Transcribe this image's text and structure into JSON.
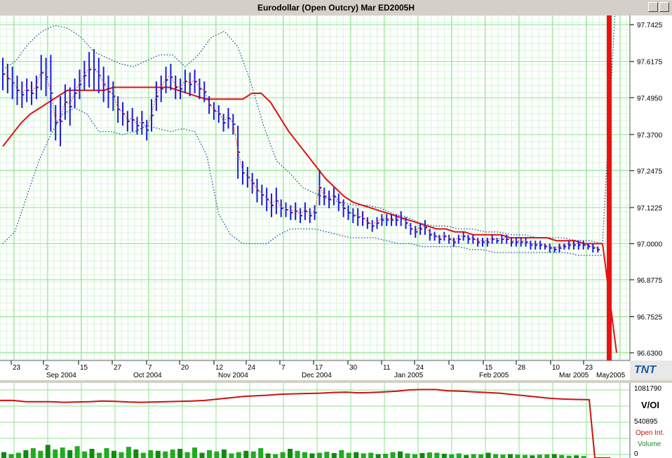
{
  "window": {
    "title": "Eurodollar (Open Outcry) Mar ED2005H"
  },
  "price_axis": {
    "labels": [
      "97.7425",
      "97.6175",
      "97.4950",
      "97.3700",
      "97.2475",
      "97.1225",
      "97.0000",
      "96.8775",
      "96.7525",
      "96.6300"
    ]
  },
  "date_axis": {
    "day_labels": [
      "23",
      "2",
      "15",
      "27",
      "7",
      "20",
      "12",
      "24",
      "7",
      "17",
      "30",
      "11",
      "24",
      "3",
      "15",
      "28",
      "10",
      "23"
    ],
    "month_labels": [
      "Sep 2004",
      "Oct 2004",
      "Nov 2004",
      "Dec 2004",
      "Jan 2005",
      "Feb 2005",
      "Mar 2005",
      "May2005"
    ]
  },
  "logo": {
    "text": "TNT"
  },
  "lower_panel": {
    "axis_labels": [
      "1081790",
      "540895",
      "0"
    ],
    "title": "V/OI",
    "legend": [
      "Open Int.",
      "Volume"
    ]
  },
  "colors": {
    "grid": "#8fe38f",
    "bars": "#1a1adc",
    "ma": "#e01010",
    "bands": "#1a4a9a",
    "volume": "#22aa22",
    "oi": "#d01010",
    "bg": "#ffffff"
  },
  "chart_data": [
    {
      "type": "ohlc",
      "title": "Eurodollar (Open Outcry) Mar ED2005H",
      "ylim": [
        96.63,
        97.8
      ],
      "yticks": [
        97.7425,
        97.6175,
        97.495,
        97.37,
        97.2475,
        97.1225,
        97.0,
        96.8775,
        96.7525,
        96.63
      ],
      "bars": [
        {
          "h": 97.63,
          "l": 97.52
        },
        {
          "h": 97.61,
          "l": 97.51
        },
        {
          "h": 97.6,
          "l": 97.49
        },
        {
          "h": 97.57,
          "l": 97.47
        },
        {
          "h": 97.55,
          "l": 97.46
        },
        {
          "h": 97.56,
          "l": 97.48
        },
        {
          "h": 97.55,
          "l": 97.47
        },
        {
          "h": 97.57,
          "l": 97.49
        },
        {
          "h": 97.64,
          "l": 97.52
        },
        {
          "h": 97.63,
          "l": 97.5
        },
        {
          "h": 97.64,
          "l": 97.38
        },
        {
          "h": 97.47,
          "l": 97.35
        },
        {
          "h": 97.5,
          "l": 97.33
        },
        {
          "h": 97.54,
          "l": 97.42
        },
        {
          "h": 97.53,
          "l": 97.4
        },
        {
          "h": 97.56,
          "l": 97.46
        },
        {
          "h": 97.59,
          "l": 97.49
        },
        {
          "h": 97.62,
          "l": 97.52
        },
        {
          "h": 97.65,
          "l": 97.53
        },
        {
          "h": 97.66,
          "l": 97.52
        },
        {
          "h": 97.63,
          "l": 97.51
        },
        {
          "h": 97.6,
          "l": 97.48
        },
        {
          "h": 97.57,
          "l": 97.46
        },
        {
          "h": 97.55,
          "l": 97.45
        },
        {
          "h": 97.5,
          "l": 97.41
        },
        {
          "h": 97.48,
          "l": 97.4
        },
        {
          "h": 97.45,
          "l": 97.38
        },
        {
          "h": 97.46,
          "l": 97.38
        },
        {
          "h": 97.43,
          "l": 97.37
        },
        {
          "h": 97.45,
          "l": 97.37
        },
        {
          "h": 97.42,
          "l": 97.35
        },
        {
          "h": 97.49,
          "l": 97.38
        },
        {
          "h": 97.55,
          "l": 97.45
        },
        {
          "h": 97.57,
          "l": 97.48
        },
        {
          "h": 97.6,
          "l": 97.51
        },
        {
          "h": 97.61,
          "l": 97.52
        },
        {
          "h": 97.57,
          "l": 97.49
        },
        {
          "h": 97.56,
          "l": 97.49
        },
        {
          "h": 97.59,
          "l": 97.51
        },
        {
          "h": 97.58,
          "l": 97.5
        },
        {
          "h": 97.59,
          "l": 97.51
        },
        {
          "h": 97.56,
          "l": 97.49
        },
        {
          "h": 97.55,
          "l": 97.48
        },
        {
          "h": 97.5,
          "l": 97.44
        },
        {
          "h": 97.48,
          "l": 97.42
        },
        {
          "h": 97.47,
          "l": 97.41
        },
        {
          "h": 97.44,
          "l": 97.38
        },
        {
          "h": 97.46,
          "l": 97.39
        },
        {
          "h": 97.44,
          "l": 97.37
        },
        {
          "h": 97.4,
          "l": 97.22
        },
        {
          "h": 97.28,
          "l": 97.2
        },
        {
          "h": 97.26,
          "l": 97.19
        },
        {
          "h": 97.24,
          "l": 97.17
        },
        {
          "h": 97.22,
          "l": 97.14
        },
        {
          "h": 97.2,
          "l": 97.13
        },
        {
          "h": 97.19,
          "l": 97.11
        },
        {
          "h": 97.17,
          "l": 97.09
        },
        {
          "h": 97.19,
          "l": 97.1
        },
        {
          "h": 97.15,
          "l": 97.09
        },
        {
          "h": 97.14,
          "l": 97.09
        },
        {
          "h": 97.13,
          "l": 97.08
        },
        {
          "h": 97.14,
          "l": 97.08
        },
        {
          "h": 97.12,
          "l": 97.07
        },
        {
          "h": 97.14,
          "l": 97.08
        },
        {
          "h": 97.12,
          "l": 97.07
        },
        {
          "h": 97.13,
          "l": 97.08
        },
        {
          "h": 97.25,
          "l": 97.13
        },
        {
          "h": 97.19,
          "l": 97.13
        },
        {
          "h": 97.18,
          "l": 97.12
        },
        {
          "h": 97.19,
          "l": 97.13
        },
        {
          "h": 97.17,
          "l": 97.11
        },
        {
          "h": 97.15,
          "l": 97.09
        },
        {
          "h": 97.13,
          "l": 97.08
        },
        {
          "h": 97.12,
          "l": 97.07
        },
        {
          "h": 97.12,
          "l": 97.06
        },
        {
          "h": 97.11,
          "l": 97.06
        },
        {
          "h": 97.09,
          "l": 97.05
        },
        {
          "h": 97.08,
          "l": 97.04
        },
        {
          "h": 97.09,
          "l": 97.05
        },
        {
          "h": 97.1,
          "l": 97.06
        },
        {
          "h": 97.1,
          "l": 97.06
        },
        {
          "h": 97.1,
          "l": 97.06
        },
        {
          "h": 97.1,
          "l": 97.06
        },
        {
          "h": 97.11,
          "l": 97.06
        },
        {
          "h": 97.09,
          "l": 97.05
        },
        {
          "h": 97.07,
          "l": 97.03
        },
        {
          "h": 97.06,
          "l": 97.02
        },
        {
          "h": 97.07,
          "l": 97.03
        },
        {
          "h": 97.08,
          "l": 97.03
        },
        {
          "h": 97.05,
          "l": 97.01
        },
        {
          "h": 97.04,
          "l": 97.01
        },
        {
          "h": 97.03,
          "l": 97.0
        },
        {
          "h": 97.04,
          "l": 97.01
        },
        {
          "h": 97.03,
          "l": 97.0
        },
        {
          "h": 97.02,
          "l": 96.99
        },
        {
          "h": 97.03,
          "l": 97.0
        },
        {
          "h": 97.04,
          "l": 97.01
        },
        {
          "h": 97.03,
          "l": 97.0
        },
        {
          "h": 97.03,
          "l": 97.0
        },
        {
          "h": 97.02,
          "l": 96.99
        },
        {
          "h": 97.02,
          "l": 96.99
        },
        {
          "h": 97.02,
          "l": 96.99
        },
        {
          "h": 97.03,
          "l": 97.0
        },
        {
          "h": 97.02,
          "l": 97.0
        },
        {
          "h": 97.03,
          "l": 97.0
        },
        {
          "h": 97.03,
          "l": 97.0
        },
        {
          "h": 97.02,
          "l": 96.99
        },
        {
          "h": 97.02,
          "l": 96.99
        },
        {
          "h": 97.02,
          "l": 96.99
        },
        {
          "h": 97.02,
          "l": 96.99
        },
        {
          "h": 97.01,
          "l": 96.98
        },
        {
          "h": 97.01,
          "l": 96.98
        },
        {
          "h": 97.01,
          "l": 96.98
        },
        {
          "h": 97.0,
          "l": 96.98
        },
        {
          "h": 97.0,
          "l": 96.97
        },
        {
          "h": 96.99,
          "l": 96.97
        },
        {
          "h": 97.0,
          "l": 96.97
        },
        {
          "h": 97.0,
          "l": 96.98
        },
        {
          "h": 97.01,
          "l": 96.98
        },
        {
          "h": 97.01,
          "l": 96.98
        },
        {
          "h": 97.01,
          "l": 96.98
        },
        {
          "h": 97.01,
          "l": 96.98
        },
        {
          "h": 97.0,
          "l": 96.98
        },
        {
          "h": 97.0,
          "l": 96.97
        },
        {
          "h": 96.99,
          "l": 96.97
        }
      ],
      "ma": [
        97.33,
        97.37,
        97.41,
        97.44,
        97.46,
        97.48,
        97.5,
        97.52,
        97.52,
        97.52,
        97.52,
        97.52,
        97.53,
        97.53,
        97.53,
        97.53,
        97.53,
        97.53,
        97.53,
        97.52,
        97.51,
        97.5,
        97.49,
        97.49,
        97.49,
        97.49,
        97.49,
        97.51,
        97.51,
        97.48,
        97.43,
        97.38,
        97.34,
        97.3,
        97.26,
        97.22,
        97.19,
        97.16,
        97.14,
        97.13,
        97.12,
        97.11,
        97.1,
        97.09,
        97.08,
        97.07,
        97.06,
        97.05,
        97.05,
        97.04,
        97.04,
        97.03,
        97.03,
        97.03,
        97.03,
        97.02,
        97.02,
        97.02,
        97.02,
        97.02,
        97.01,
        97.01,
        97.01,
        97.0,
        97.0,
        97.0
      ],
      "band_upper": [
        97.59,
        97.62,
        97.68,
        97.72,
        97.74,
        97.73,
        97.7,
        97.65,
        97.63,
        97.61,
        97.6,
        97.62,
        97.64,
        97.64,
        97.6,
        97.64,
        97.7,
        97.72,
        97.67,
        97.55,
        97.4,
        97.28,
        97.24,
        97.19,
        97.17,
        97.15,
        97.14,
        97.13,
        97.13,
        97.12,
        97.1,
        97.09,
        97.07,
        97.06,
        97.06,
        97.05,
        97.05,
        97.04,
        97.04,
        97.03,
        97.03,
        97.02,
        97.02,
        97.02,
        97.01,
        97.01,
        97.0,
        97.82,
        97.82
      ],
      "band_lower": [
        97.0,
        97.04,
        97.16,
        97.28,
        97.37,
        97.44,
        97.46,
        97.44,
        97.38,
        97.38,
        97.37,
        97.38,
        97.4,
        97.39,
        97.38,
        97.39,
        97.38,
        97.3,
        97.1,
        97.03,
        97.0,
        97.0,
        97.0,
        97.03,
        97.05,
        97.05,
        97.05,
        97.04,
        97.03,
        97.02,
        97.02,
        97.02,
        97.01,
        97.0,
        97.0,
        96.99,
        96.99,
        96.99,
        96.99,
        96.98,
        96.98,
        96.97,
        96.97,
        96.97,
        96.97,
        96.97,
        96.97,
        96.97,
        96.96,
        96.96,
        96.96
      ],
      "ma_projection": [
        97.0,
        96.63
      ]
    },
    {
      "type": "bar",
      "ylim": [
        0,
        1081790
      ],
      "yticks": [
        1081790,
        540895,
        0
      ],
      "series": [
        {
          "name": "Open Int.",
          "type": "line",
          "values": [
            880000,
            880000,
            860000,
            860000,
            860000,
            850000,
            855000,
            860000,
            870000,
            865000,
            855000,
            850000,
            855000,
            860000,
            865000,
            870000,
            880000,
            900000,
            920000,
            940000,
            950000,
            960000,
            975000,
            980000,
            985000,
            990000,
            1000000,
            1005000,
            995000,
            1000000,
            1010000,
            1020000,
            1040000,
            1045000,
            1045000,
            1025000,
            1020000,
            1010000,
            1000000,
            990000,
            970000,
            950000,
            930000,
            910000,
            900000,
            895000,
            890000,
            0,
            0
          ]
        },
        {
          "name": "Volume",
          "type": "bar",
          "values": [
            90000,
            60000,
            80000,
            120000,
            150000,
            110000,
            200000,
            130000,
            160000,
            120000,
            180000,
            100000,
            140000,
            80000,
            150000,
            110000,
            90000,
            170000,
            130000,
            80000,
            120000,
            110000,
            100000,
            130000,
            140000,
            90000,
            160000,
            80000,
            120000,
            100000,
            130000,
            70000,
            90000,
            110000,
            100000,
            150000,
            70000,
            60000,
            90000,
            140000,
            110000,
            90000,
            70000,
            80000,
            95000,
            75000,
            120000,
            80000,
            90000,
            70000,
            80000,
            60000,
            65000,
            90000,
            100000,
            70000,
            60000,
            75000,
            85000,
            80000,
            65000,
            55000,
            70000,
            45000,
            60000,
            55000,
            80000,
            60000,
            50000,
            60000,
            50000,
            45000,
            40000,
            50000,
            55000,
            60000,
            45000,
            35000,
            40000,
            30000,
            0,
            0
          ]
        }
      ]
    }
  ]
}
